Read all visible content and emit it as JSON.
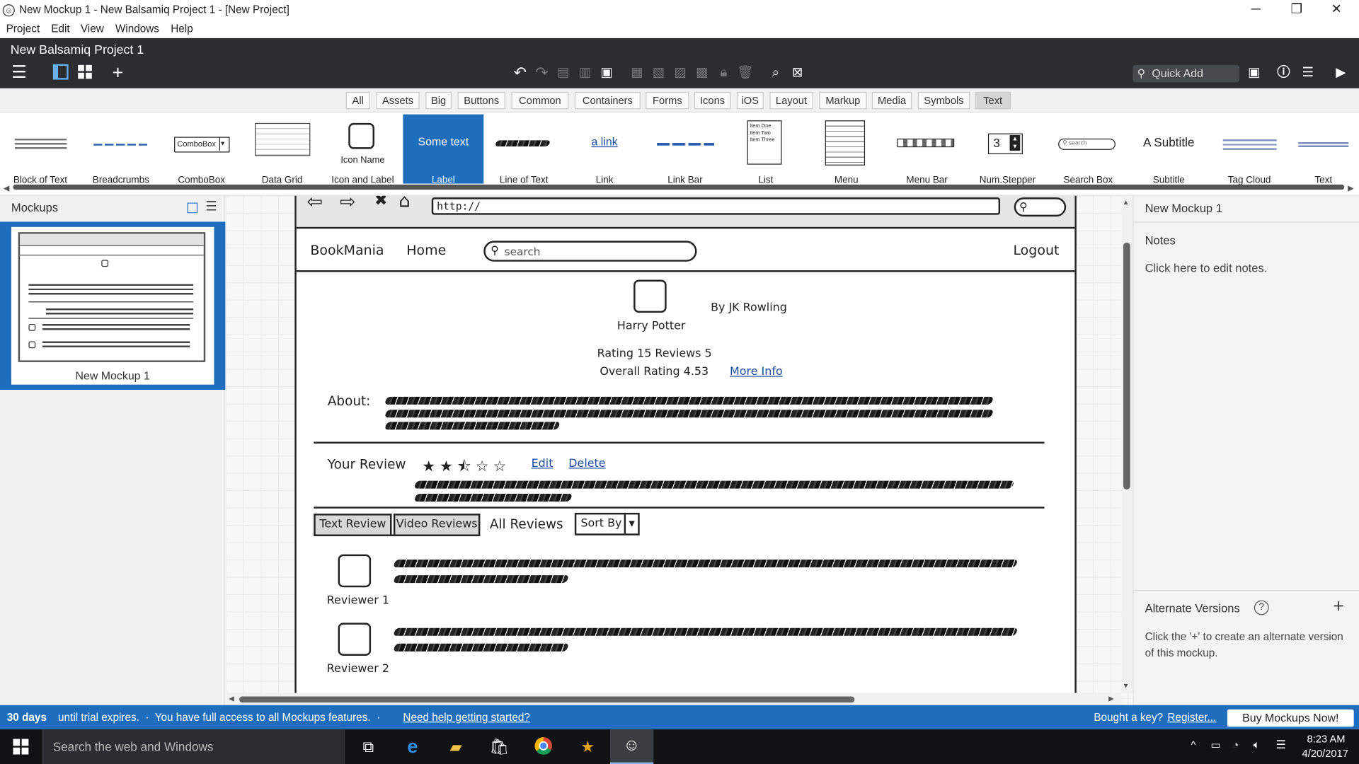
{
  "window": {
    "title": "New Mockup 1 - New Balsamiq Project 1 - [New Project]",
    "minimize": "─",
    "restore": "❐",
    "close": "✕"
  },
  "menu": [
    "Project",
    "Edit",
    "View",
    "Windows",
    "Help"
  ],
  "project": {
    "name": "New Balsamiq Project 1",
    "quick_add_placeholder": "Quick Add"
  },
  "filters": [
    "All",
    "Assets",
    "Big",
    "Buttons",
    "Common",
    "Containers",
    "Forms",
    "Icons",
    "iOS",
    "Layout",
    "Markup",
    "Media",
    "Symbols",
    "Text"
  ],
  "selected_filter": "Text",
  "library": {
    "items": [
      "Block of Text",
      "Breadcrumbs",
      "ComboBox",
      "Data Grid",
      "Icon and Label",
      "Label",
      "Line of Text",
      "Link",
      "Link Bar",
      "List",
      "Menu",
      "Menu Bar",
      "Num.Stepper",
      "Search Box",
      "Subtitle",
      "Tag Cloud",
      "Text"
    ],
    "selected": "Label",
    "previews": {
      "combobox": "ComboBox",
      "icon_name": "Icon Name",
      "label": "Some text",
      "link": "a link",
      "list": [
        "Item One",
        "Item Two",
        "Item Three"
      ],
      "stepper": "3",
      "search": "search",
      "subtitle": "A Subtitle"
    }
  },
  "mockups_panel": {
    "header": "Mockups",
    "items": [
      "New Mockup 1"
    ]
  },
  "mockup": {
    "url": "http://",
    "brand": "BookMania",
    "home": "Home",
    "search_placeholder": "search",
    "logout": "Logout",
    "book_title": "Harry Potter",
    "author": "By JK Rowling",
    "rating_line": "Rating 15 Reviews 5",
    "overall": "Overall Rating 4.53",
    "more_info": "More Info",
    "about_label": "About:",
    "your_review": "Your Review",
    "stars": [
      "★",
      "★",
      "⯪",
      "☆",
      "☆"
    ],
    "edit": "Edit",
    "delete": "Delete",
    "tabs": [
      "Text Review",
      "Video Reviews"
    ],
    "all_reviews": "All Reviews",
    "sort_by": "Sort By",
    "reviewers": [
      "Reviewer 1",
      "Reviewer 2"
    ]
  },
  "right_panel": {
    "title": "New Mockup 1",
    "notes_label": "Notes",
    "notes_hint": "Click here to edit notes.",
    "alt_versions": "Alternate Versions",
    "help": "?",
    "add": "+",
    "alt_hint": "Click the '+' to create an alternate version of this mockup."
  },
  "trial_bar": {
    "days": "30 days",
    "text": "until trial expires.  ·  You have full access to all Mockups features.  · ",
    "help_link": "Need help getting started?",
    "bought": "Bought a key?",
    "register": "Register...",
    "buy": "Buy Mockups Now!"
  },
  "taskbar": {
    "search_placeholder": "Search the web and Windows",
    "time": "8:23 AM",
    "date": "4/20/2017"
  },
  "colors": {
    "accent": "#1f6ebd",
    "dark_bar": "#2b2d2f",
    "link": "#1b4ea3"
  }
}
